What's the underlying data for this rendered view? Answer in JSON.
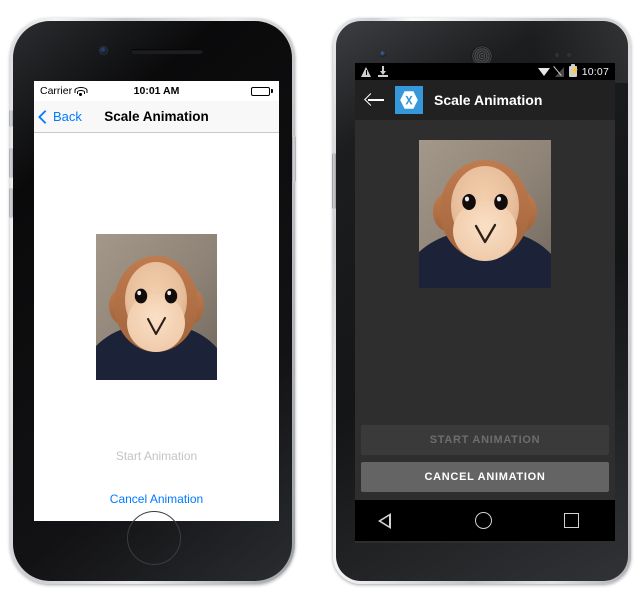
{
  "ios": {
    "status": {
      "carrier": "Carrier",
      "wifi_icon": "wifi-icon",
      "time": "10:01 AM",
      "battery_icon": "battery-icon"
    },
    "nav": {
      "back_label": "Back",
      "back_icon": "chevron-left-icon",
      "title": "Scale Animation"
    },
    "content": {
      "image_alt": "monkey-photo"
    },
    "actions": {
      "start_label": "Start Animation",
      "start_enabled": false,
      "cancel_label": "Cancel Animation",
      "cancel_enabled": true
    },
    "colors": {
      "accent": "#007aff",
      "disabled_text": "#c4c4c6",
      "navbar_bg": "#f8f8f8",
      "screen_bg": "#ffffff"
    },
    "hardware": {
      "camera": "front-camera",
      "speaker": "earpiece-speaker",
      "home_button": "home-button"
    }
  },
  "android": {
    "status": {
      "warning_icon": "warning-triangle-icon",
      "download_icon": "download-icon",
      "wifi_icon": "wifi-icon",
      "signal_icon": "signal-off-icon",
      "battery_icon": "battery-charging-icon",
      "time": "10:07"
    },
    "action_bar": {
      "back_icon": "arrow-back-icon",
      "app_logo": "xamarin-logo-icon",
      "title": "Scale Animation"
    },
    "content": {
      "image_alt": "monkey-photo"
    },
    "actions": {
      "start_label": "START ANIMATION",
      "start_enabled": false,
      "cancel_label": "CANCEL ANIMATION",
      "cancel_enabled": true
    },
    "navbar": {
      "back_icon": "nav-back-triangle-icon",
      "home_icon": "nav-home-circle-icon",
      "recents_icon": "nav-recents-square-icon"
    },
    "colors": {
      "accent": "#3498db",
      "actionbar_bg": "#212121",
      "screen_bg": "#2e2e2e",
      "button_disabled_bg": "#3a3a3a",
      "button_enabled_bg": "#646464",
      "statusbar_bg": "#000000"
    },
    "hardware": {
      "camera": "front-camera",
      "speaker": "earpiece-speaker",
      "sensors": "proximity-sensors"
    }
  }
}
